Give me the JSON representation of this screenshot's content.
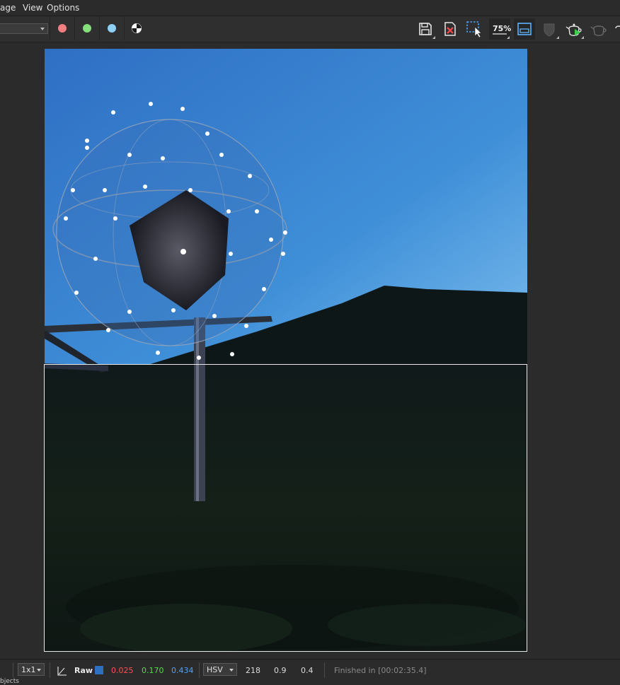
{
  "menu": {
    "items": [
      "age",
      "View",
      "Options"
    ]
  },
  "toolbar": {
    "channels": [
      {
        "name": "red-channel",
        "color": "#f28080"
      },
      {
        "name": "green-channel",
        "color": "#86e07a"
      },
      {
        "name": "blue-channel",
        "color": "#8fd0f5"
      }
    ],
    "zoom_label": "75%"
  },
  "statusbar": {
    "scale": "1x1",
    "raw_label": "Raw",
    "swatch_color": "#2f6fc0",
    "r": "0.025",
    "g": "0.170",
    "b": "0.434",
    "mode": "HSV",
    "h": "218",
    "s": "0.9",
    "v": "0.4",
    "status": "Finished in [00:02:35.4]",
    "colors": {
      "r": "#ff5050",
      "g": "#55d94a",
      "b": "#4aa3ff"
    }
  },
  "bottom_cut_text": "bjects"
}
